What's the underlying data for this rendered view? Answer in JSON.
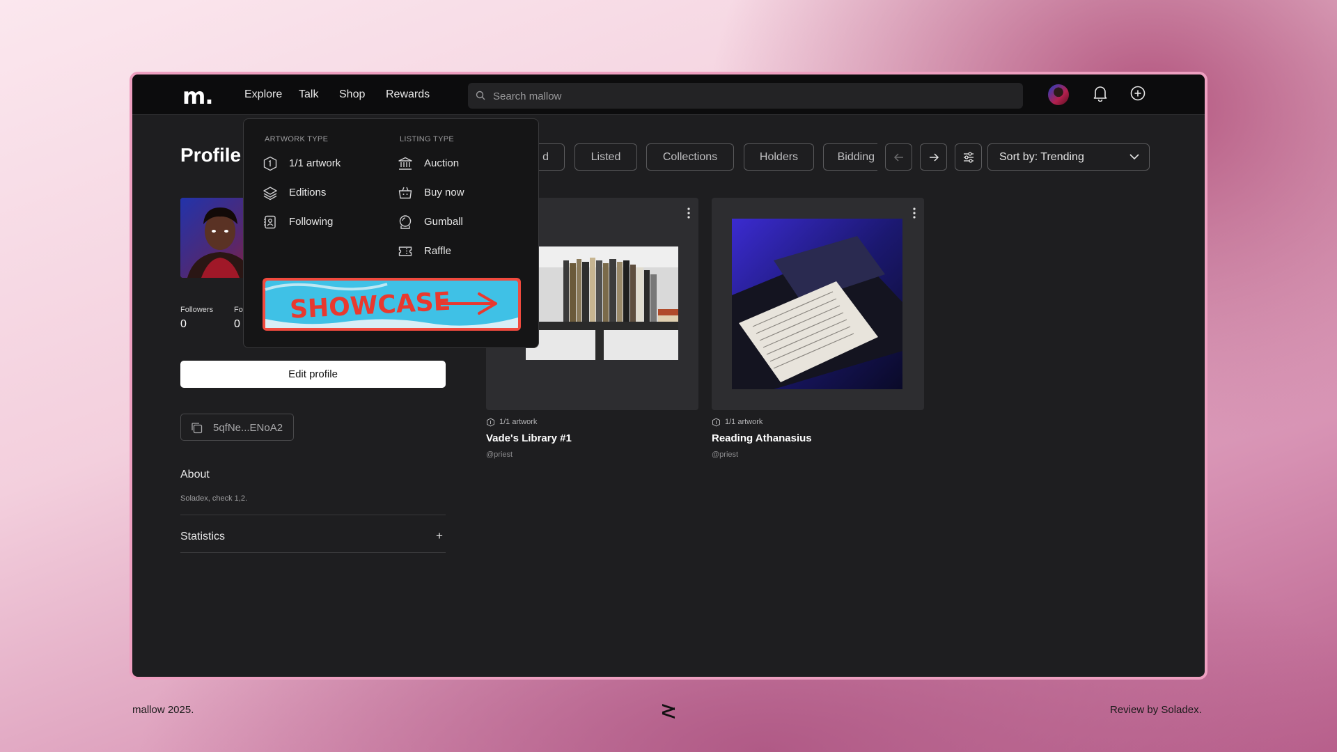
{
  "app": {
    "logo": "m.",
    "nav": [
      "Explore",
      "Talk",
      "Shop",
      "Rewards"
    ],
    "search_placeholder": "Search mallow"
  },
  "profile": {
    "title": "Profile",
    "stats": [
      {
        "label": "Followers",
        "value": "0"
      },
      {
        "label": "Fo",
        "value": "0"
      }
    ],
    "edit_label": "Edit profile",
    "wallet": "5qfNe...ENoA2",
    "about_heading": "About",
    "about_text": "Soladex, check 1,2.",
    "statistics_heading": "Statistics",
    "statistics_toggle": "+"
  },
  "tabs": [
    "d",
    "Listed",
    "Collections",
    "Holders",
    "Bidding"
  ],
  "sort_label": "Sort by: Trending",
  "dropdown": {
    "artwork_heading": "ARTWORK TYPE",
    "listing_heading": "LISTING TYPE",
    "artwork_items": [
      {
        "label": "1/1 artwork",
        "icon": "one-of-one-icon"
      },
      {
        "label": "Editions",
        "icon": "layers-icon"
      },
      {
        "label": "Following",
        "icon": "following-icon"
      }
    ],
    "listing_items": [
      {
        "label": "Auction",
        "icon": "auction-icon"
      },
      {
        "label": "Buy now",
        "icon": "basket-icon"
      },
      {
        "label": "Gumball",
        "icon": "gumball-icon"
      },
      {
        "label": "Raffle",
        "icon": "ticket-icon"
      }
    ],
    "banner_text": "SHOWCASE"
  },
  "cards": [
    {
      "type": "1/1 artwork",
      "title": "Vade's Library #1",
      "user": "@priest"
    },
    {
      "type": "1/1 artwork",
      "title": "Reading Athanasius",
      "user": "@priest"
    }
  ],
  "footer": {
    "left": "mallow 2025.",
    "right": "Review by Soladex."
  },
  "colors": {
    "app_bg": "#1e1e20",
    "topbar_bg": "#0c0c0d",
    "frame": "#ee9fc0",
    "banner_blue": "#3fc1e6",
    "banner_red": "#e8392f"
  }
}
